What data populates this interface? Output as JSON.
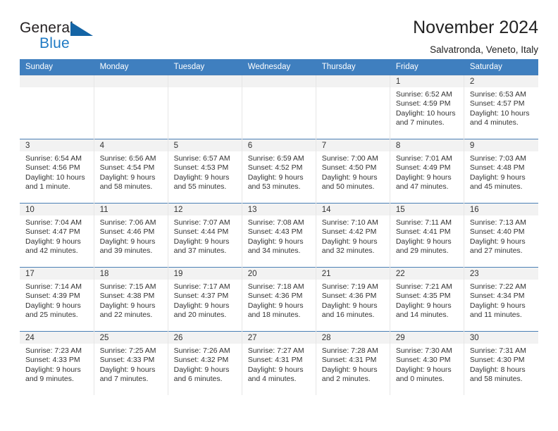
{
  "brand": {
    "word_one": "General",
    "word_two": "Blue",
    "triangle_icon": "triangle-icon"
  },
  "header": {
    "title": "November 2024",
    "subtitle": "Salvatronda, Veneto, Italy"
  },
  "colors": {
    "header_blue": "#3f7fbf",
    "brand_blue": "#1f7ac4",
    "daynum_bg": "#f2f2f2",
    "row_border": "#4a7fb5"
  },
  "weekdays": [
    "Sunday",
    "Monday",
    "Tuesday",
    "Wednesday",
    "Thursday",
    "Friday",
    "Saturday"
  ],
  "weeks": [
    [
      {
        "day": "",
        "empty": true
      },
      {
        "day": "",
        "empty": true
      },
      {
        "day": "",
        "empty": true
      },
      {
        "day": "",
        "empty": true
      },
      {
        "day": "",
        "empty": true
      },
      {
        "day": "1",
        "sunrise": "Sunrise: 6:52 AM",
        "sunset": "Sunset: 4:59 PM",
        "daylight1": "Daylight: 10 hours",
        "daylight2": "and 7 minutes."
      },
      {
        "day": "2",
        "sunrise": "Sunrise: 6:53 AM",
        "sunset": "Sunset: 4:57 PM",
        "daylight1": "Daylight: 10 hours",
        "daylight2": "and 4 minutes."
      }
    ],
    [
      {
        "day": "3",
        "sunrise": "Sunrise: 6:54 AM",
        "sunset": "Sunset: 4:56 PM",
        "daylight1": "Daylight: 10 hours",
        "daylight2": "and 1 minute."
      },
      {
        "day": "4",
        "sunrise": "Sunrise: 6:56 AM",
        "sunset": "Sunset: 4:54 PM",
        "daylight1": "Daylight: 9 hours",
        "daylight2": "and 58 minutes."
      },
      {
        "day": "5",
        "sunrise": "Sunrise: 6:57 AM",
        "sunset": "Sunset: 4:53 PM",
        "daylight1": "Daylight: 9 hours",
        "daylight2": "and 55 minutes."
      },
      {
        "day": "6",
        "sunrise": "Sunrise: 6:59 AM",
        "sunset": "Sunset: 4:52 PM",
        "daylight1": "Daylight: 9 hours",
        "daylight2": "and 53 minutes."
      },
      {
        "day": "7",
        "sunrise": "Sunrise: 7:00 AM",
        "sunset": "Sunset: 4:50 PM",
        "daylight1": "Daylight: 9 hours",
        "daylight2": "and 50 minutes."
      },
      {
        "day": "8",
        "sunrise": "Sunrise: 7:01 AM",
        "sunset": "Sunset: 4:49 PM",
        "daylight1": "Daylight: 9 hours",
        "daylight2": "and 47 minutes."
      },
      {
        "day": "9",
        "sunrise": "Sunrise: 7:03 AM",
        "sunset": "Sunset: 4:48 PM",
        "daylight1": "Daylight: 9 hours",
        "daylight2": "and 45 minutes."
      }
    ],
    [
      {
        "day": "10",
        "sunrise": "Sunrise: 7:04 AM",
        "sunset": "Sunset: 4:47 PM",
        "daylight1": "Daylight: 9 hours",
        "daylight2": "and 42 minutes."
      },
      {
        "day": "11",
        "sunrise": "Sunrise: 7:06 AM",
        "sunset": "Sunset: 4:46 PM",
        "daylight1": "Daylight: 9 hours",
        "daylight2": "and 39 minutes."
      },
      {
        "day": "12",
        "sunrise": "Sunrise: 7:07 AM",
        "sunset": "Sunset: 4:44 PM",
        "daylight1": "Daylight: 9 hours",
        "daylight2": "and 37 minutes."
      },
      {
        "day": "13",
        "sunrise": "Sunrise: 7:08 AM",
        "sunset": "Sunset: 4:43 PM",
        "daylight1": "Daylight: 9 hours",
        "daylight2": "and 34 minutes."
      },
      {
        "day": "14",
        "sunrise": "Sunrise: 7:10 AM",
        "sunset": "Sunset: 4:42 PM",
        "daylight1": "Daylight: 9 hours",
        "daylight2": "and 32 minutes."
      },
      {
        "day": "15",
        "sunrise": "Sunrise: 7:11 AM",
        "sunset": "Sunset: 4:41 PM",
        "daylight1": "Daylight: 9 hours",
        "daylight2": "and 29 minutes."
      },
      {
        "day": "16",
        "sunrise": "Sunrise: 7:13 AM",
        "sunset": "Sunset: 4:40 PM",
        "daylight1": "Daylight: 9 hours",
        "daylight2": "and 27 minutes."
      }
    ],
    [
      {
        "day": "17",
        "sunrise": "Sunrise: 7:14 AM",
        "sunset": "Sunset: 4:39 PM",
        "daylight1": "Daylight: 9 hours",
        "daylight2": "and 25 minutes."
      },
      {
        "day": "18",
        "sunrise": "Sunrise: 7:15 AM",
        "sunset": "Sunset: 4:38 PM",
        "daylight1": "Daylight: 9 hours",
        "daylight2": "and 22 minutes."
      },
      {
        "day": "19",
        "sunrise": "Sunrise: 7:17 AM",
        "sunset": "Sunset: 4:37 PM",
        "daylight1": "Daylight: 9 hours",
        "daylight2": "and 20 minutes."
      },
      {
        "day": "20",
        "sunrise": "Sunrise: 7:18 AM",
        "sunset": "Sunset: 4:36 PM",
        "daylight1": "Daylight: 9 hours",
        "daylight2": "and 18 minutes."
      },
      {
        "day": "21",
        "sunrise": "Sunrise: 7:19 AM",
        "sunset": "Sunset: 4:36 PM",
        "daylight1": "Daylight: 9 hours",
        "daylight2": "and 16 minutes."
      },
      {
        "day": "22",
        "sunrise": "Sunrise: 7:21 AM",
        "sunset": "Sunset: 4:35 PM",
        "daylight1": "Daylight: 9 hours",
        "daylight2": "and 14 minutes."
      },
      {
        "day": "23",
        "sunrise": "Sunrise: 7:22 AM",
        "sunset": "Sunset: 4:34 PM",
        "daylight1": "Daylight: 9 hours",
        "daylight2": "and 11 minutes."
      }
    ],
    [
      {
        "day": "24",
        "sunrise": "Sunrise: 7:23 AM",
        "sunset": "Sunset: 4:33 PM",
        "daylight1": "Daylight: 9 hours",
        "daylight2": "and 9 minutes."
      },
      {
        "day": "25",
        "sunrise": "Sunrise: 7:25 AM",
        "sunset": "Sunset: 4:33 PM",
        "daylight1": "Daylight: 9 hours",
        "daylight2": "and 7 minutes."
      },
      {
        "day": "26",
        "sunrise": "Sunrise: 7:26 AM",
        "sunset": "Sunset: 4:32 PM",
        "daylight1": "Daylight: 9 hours",
        "daylight2": "and 6 minutes."
      },
      {
        "day": "27",
        "sunrise": "Sunrise: 7:27 AM",
        "sunset": "Sunset: 4:31 PM",
        "daylight1": "Daylight: 9 hours",
        "daylight2": "and 4 minutes."
      },
      {
        "day": "28",
        "sunrise": "Sunrise: 7:28 AM",
        "sunset": "Sunset: 4:31 PM",
        "daylight1": "Daylight: 9 hours",
        "daylight2": "and 2 minutes."
      },
      {
        "day": "29",
        "sunrise": "Sunrise: 7:30 AM",
        "sunset": "Sunset: 4:30 PM",
        "daylight1": "Daylight: 9 hours",
        "daylight2": "and 0 minutes."
      },
      {
        "day": "30",
        "sunrise": "Sunrise: 7:31 AM",
        "sunset": "Sunset: 4:30 PM",
        "daylight1": "Daylight: 8 hours",
        "daylight2": "and 58 minutes."
      }
    ]
  ]
}
